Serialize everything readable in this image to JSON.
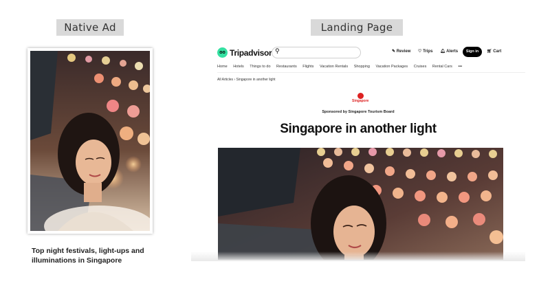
{
  "labels": {
    "native": "Native Ad",
    "landing": "Landing Page"
  },
  "native_ad": {
    "caption": "Top night festivals, light-ups and illuminations in Singapore"
  },
  "landing": {
    "brand": "Tripadvisor",
    "logo_mark": "oo",
    "header_links": [
      "Review",
      "Trips",
      "Alerts"
    ],
    "signin": "Sign in",
    "cart": "Cart",
    "nav_items": [
      "Home",
      "Hotels",
      "Things to do",
      "Restaurants",
      "Flights",
      "Vacation Rentals",
      "Shopping",
      "Vacation Packages",
      "Cruises",
      "Rental Cars",
      "•••"
    ],
    "breadcrumb": "All Articles  ›  Singapore in another light",
    "sponsor_logo_text": "Singapore",
    "sponsor": "Sponsored by Singapore Tourism Board",
    "headline": "Singapore in another light"
  },
  "colors": {
    "brand_green": "#34e0a1",
    "sponsor_red": "#dd2222"
  },
  "icons": [
    "search-icon",
    "pencil-icon",
    "heart-icon",
    "bell-icon",
    "cart-icon"
  ]
}
